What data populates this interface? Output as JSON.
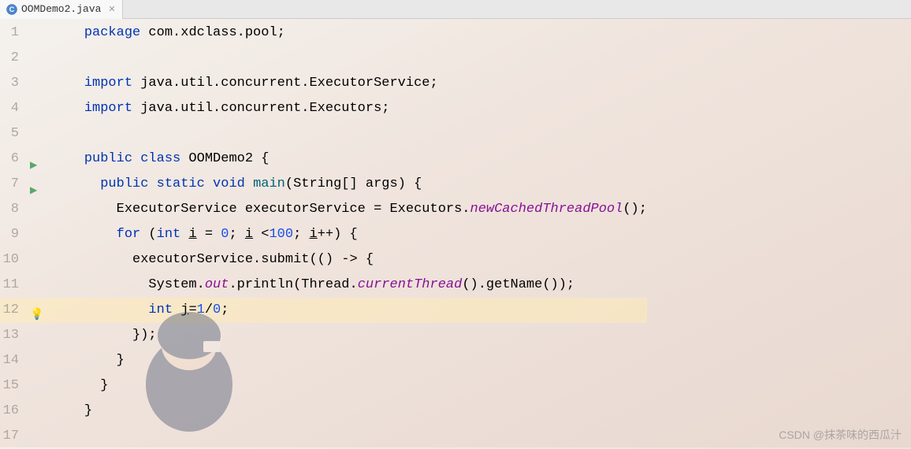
{
  "tab": {
    "filename": "OOMDemo2.java",
    "icon": "java-class-icon"
  },
  "watermark": "CSDN @抹茶味的西瓜汁",
  "code": {
    "lines": [
      {
        "n": 1,
        "tokens": [
          {
            "t": "kw",
            "v": "package"
          },
          {
            "t": "txt",
            "v": " com.xdclass.pool;"
          }
        ]
      },
      {
        "n": 2,
        "tokens": []
      },
      {
        "n": 3,
        "tokens": [
          {
            "t": "kw",
            "v": "import"
          },
          {
            "t": "txt",
            "v": " java.util.concurrent.ExecutorService;"
          }
        ]
      },
      {
        "n": 4,
        "tokens": [
          {
            "t": "kw",
            "v": "import"
          },
          {
            "t": "txt",
            "v": " java.util.concurrent.Executors;"
          }
        ]
      },
      {
        "n": 5,
        "tokens": []
      },
      {
        "n": 6,
        "gutter": "run",
        "tokens": [
          {
            "t": "kw",
            "v": "public class"
          },
          {
            "t": "txt",
            "v": " OOMDemo2 {"
          }
        ]
      },
      {
        "n": 7,
        "gutter": "run",
        "indent": 1,
        "tokens": [
          {
            "t": "kw",
            "v": "public static void"
          },
          {
            "t": "txt",
            "v": " "
          },
          {
            "t": "method",
            "v": "main"
          },
          {
            "t": "txt",
            "v": "(String[] args) {"
          }
        ]
      },
      {
        "n": 8,
        "indent": 2,
        "tokens": [
          {
            "t": "txt",
            "v": "ExecutorService executorService = Executors."
          },
          {
            "t": "static",
            "v": "newCachedThreadPool"
          },
          {
            "t": "txt",
            "v": "();"
          }
        ]
      },
      {
        "n": 9,
        "indent": 2,
        "tokens": [
          {
            "t": "kw",
            "v": "for"
          },
          {
            "t": "txt",
            "v": " ("
          },
          {
            "t": "kw",
            "v": "int"
          },
          {
            "t": "txt",
            "v": " "
          },
          {
            "t": "u",
            "v": "i"
          },
          {
            "t": "txt",
            "v": " = "
          },
          {
            "t": "num",
            "v": "0"
          },
          {
            "t": "txt",
            "v": "; "
          },
          {
            "t": "u",
            "v": "i"
          },
          {
            "t": "txt",
            "v": " <"
          },
          {
            "t": "num",
            "v": "100"
          },
          {
            "t": "txt",
            "v": "; "
          },
          {
            "t": "u",
            "v": "i"
          },
          {
            "t": "txt",
            "v": "++) {"
          }
        ]
      },
      {
        "n": 10,
        "indent": 3,
        "tokens": [
          {
            "t": "txt",
            "v": "executorService.submit(() -> {"
          }
        ]
      },
      {
        "n": 11,
        "indent": 4,
        "tokens": [
          {
            "t": "txt",
            "v": "System."
          },
          {
            "t": "static",
            "v": "out"
          },
          {
            "t": "txt",
            "v": ".println(Thread."
          },
          {
            "t": "static",
            "v": "currentThread"
          },
          {
            "t": "txt",
            "v": "().getName());"
          }
        ]
      },
      {
        "n": 12,
        "gutter": "bulb",
        "highlight": true,
        "indent": 4,
        "tokens": [
          {
            "t": "kw",
            "v": "int"
          },
          {
            "t": "txt",
            "v": " "
          },
          {
            "t": "u",
            "v": "j"
          },
          {
            "t": "txt",
            "v": "="
          },
          {
            "t": "num",
            "v": "1"
          },
          {
            "t": "txt",
            "v": "/"
          },
          {
            "t": "num",
            "v": "0"
          },
          {
            "t": "txt",
            "v": ";"
          }
        ]
      },
      {
        "n": 13,
        "indent": 3,
        "tokens": [
          {
            "t": "txt",
            "v": "});"
          }
        ]
      },
      {
        "n": 14,
        "indent": 2,
        "tokens": [
          {
            "t": "txt",
            "v": "}"
          }
        ]
      },
      {
        "n": 15,
        "indent": 1,
        "tokens": [
          {
            "t": "txt",
            "v": "}"
          }
        ]
      },
      {
        "n": 16,
        "tokens": [
          {
            "t": "txt",
            "v": "}"
          }
        ]
      },
      {
        "n": 17,
        "tokens": []
      }
    ]
  }
}
